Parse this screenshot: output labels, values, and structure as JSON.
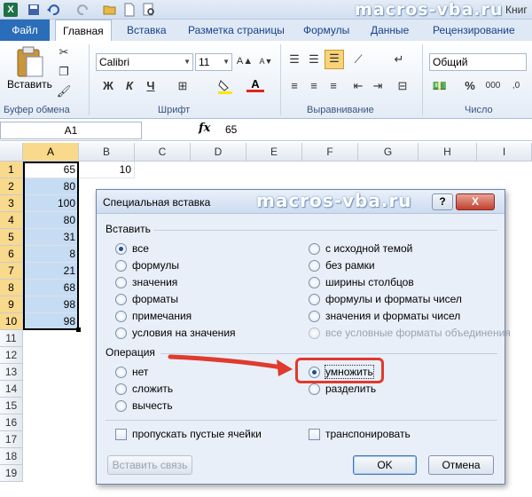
{
  "window": {
    "watermark": "macros-vba.ru",
    "book_title": "Книг"
  },
  "tabs": [
    "Файл",
    "Главная",
    "Вставка",
    "Разметка страницы",
    "Формулы",
    "Данные",
    "Рецензирование"
  ],
  "ribbon": {
    "paste_label": "Вставить",
    "font_name": "Calibri",
    "font_size": "11",
    "number_format": "Общий",
    "bold": "Ж",
    "italic": "К",
    "underline": "Ч",
    "font_color_letter": "A",
    "percent": "%",
    "groups": [
      "Буфер обмена",
      "Шрифт",
      "Выравнивание",
      "Число"
    ]
  },
  "formula_bar": {
    "name_box": "A1",
    "fx": "fx",
    "value": "65"
  },
  "columns": [
    "A",
    "B",
    "C",
    "D",
    "E",
    "F",
    "G",
    "H",
    "I"
  ],
  "rows": [
    "1",
    "2",
    "3",
    "4",
    "5",
    "6",
    "7",
    "8",
    "9",
    "10",
    "11",
    "12",
    "13",
    "14",
    "15",
    "16",
    "17",
    "18",
    "19"
  ],
  "colA_values": [
    "65",
    "80",
    "100",
    "80",
    "31",
    "8",
    "21",
    "68",
    "98",
    "98"
  ],
  "b1_value": "10",
  "dialog": {
    "title": "Специальная вставка",
    "watermark": "macros-vba.ru",
    "help": "?",
    "close": "X",
    "paste_section": "Вставить",
    "paste_left": [
      "все",
      "формулы",
      "значения",
      "форматы",
      "примечания",
      "условия на значения"
    ],
    "paste_right": [
      "с исходной темой",
      "без рамки",
      "ширины столбцов",
      "формулы и форматы чисел",
      "значения и форматы чисел",
      "все условные форматы объединения"
    ],
    "operation_section": "Операция",
    "op_left": [
      "нет",
      "сложить",
      "вычесть"
    ],
    "op_right": [
      "умножить",
      "разделить"
    ],
    "skip_blanks": "пропускать пустые ячейки",
    "transpose": "транспонировать",
    "paste_link": "Вставить связь",
    "ok": "OK",
    "cancel": "Отмена"
  },
  "colors": {
    "accent_red": "#e03a2e",
    "selection": "#c6dcf3",
    "header_selected": "#f9d98b"
  }
}
